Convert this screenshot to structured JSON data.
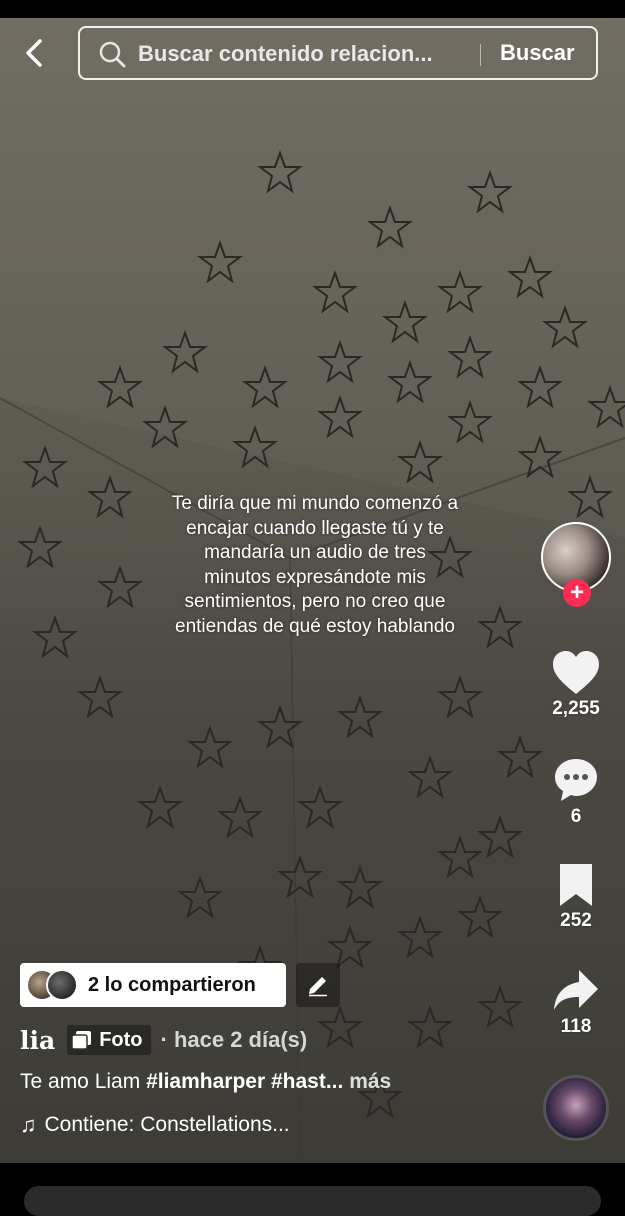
{
  "search": {
    "placeholder": "Buscar contenido relacion...",
    "button_label": "Buscar"
  },
  "overlay_text": "Te diría que mi mundo comenzó a encajar cuando llegaste tú y te mandaría un audio de tres minutos expresándote mis sentimientos, pero no creo que entiendas de qué estoy hablando",
  "follow_label": "+",
  "actions": {
    "likes": "2,255",
    "comments": "6",
    "saves": "252",
    "shares": "118"
  },
  "shared": {
    "label": "2 lo compartieron"
  },
  "post": {
    "author": "lia",
    "type_label": "Foto",
    "time": "· hace 2 día(s)",
    "description_text": "Te amo Liam ",
    "hashtag1": "#liamharper",
    "hashtag2": "#hast...",
    "more": "más",
    "music": "Contiene: Constellations..."
  },
  "icons": {
    "back": "chevron-left-icon",
    "search": "search-icon",
    "like": "heart-icon",
    "comment": "comment-icon",
    "save": "bookmark-icon",
    "share": "share-icon",
    "edit": "pencil-icon",
    "photo": "photo-stack-icon",
    "music": "music-note-icon"
  },
  "colors": {
    "follow": "#fe2c55",
    "background": "#5f5c53"
  }
}
